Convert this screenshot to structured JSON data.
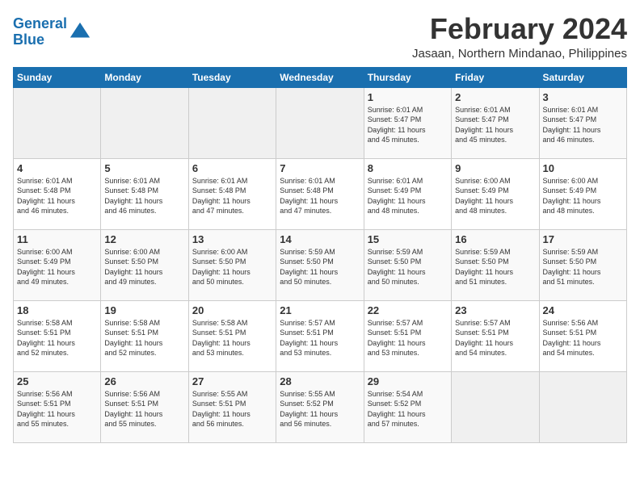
{
  "logo": {
    "line1": "General",
    "line2": "Blue"
  },
  "title": "February 2024",
  "subtitle": "Jasaan, Northern Mindanao, Philippines",
  "days_header": [
    "Sunday",
    "Monday",
    "Tuesday",
    "Wednesday",
    "Thursday",
    "Friday",
    "Saturday"
  ],
  "weeks": [
    [
      {
        "num": "",
        "info": ""
      },
      {
        "num": "",
        "info": ""
      },
      {
        "num": "",
        "info": ""
      },
      {
        "num": "",
        "info": ""
      },
      {
        "num": "1",
        "info": "Sunrise: 6:01 AM\nSunset: 5:47 PM\nDaylight: 11 hours\nand 45 minutes."
      },
      {
        "num": "2",
        "info": "Sunrise: 6:01 AM\nSunset: 5:47 PM\nDaylight: 11 hours\nand 45 minutes."
      },
      {
        "num": "3",
        "info": "Sunrise: 6:01 AM\nSunset: 5:47 PM\nDaylight: 11 hours\nand 46 minutes."
      }
    ],
    [
      {
        "num": "4",
        "info": "Sunrise: 6:01 AM\nSunset: 5:48 PM\nDaylight: 11 hours\nand 46 minutes."
      },
      {
        "num": "5",
        "info": "Sunrise: 6:01 AM\nSunset: 5:48 PM\nDaylight: 11 hours\nand 46 minutes."
      },
      {
        "num": "6",
        "info": "Sunrise: 6:01 AM\nSunset: 5:48 PM\nDaylight: 11 hours\nand 47 minutes."
      },
      {
        "num": "7",
        "info": "Sunrise: 6:01 AM\nSunset: 5:48 PM\nDaylight: 11 hours\nand 47 minutes."
      },
      {
        "num": "8",
        "info": "Sunrise: 6:01 AM\nSunset: 5:49 PM\nDaylight: 11 hours\nand 48 minutes."
      },
      {
        "num": "9",
        "info": "Sunrise: 6:00 AM\nSunset: 5:49 PM\nDaylight: 11 hours\nand 48 minutes."
      },
      {
        "num": "10",
        "info": "Sunrise: 6:00 AM\nSunset: 5:49 PM\nDaylight: 11 hours\nand 48 minutes."
      }
    ],
    [
      {
        "num": "11",
        "info": "Sunrise: 6:00 AM\nSunset: 5:49 PM\nDaylight: 11 hours\nand 49 minutes."
      },
      {
        "num": "12",
        "info": "Sunrise: 6:00 AM\nSunset: 5:50 PM\nDaylight: 11 hours\nand 49 minutes."
      },
      {
        "num": "13",
        "info": "Sunrise: 6:00 AM\nSunset: 5:50 PM\nDaylight: 11 hours\nand 50 minutes."
      },
      {
        "num": "14",
        "info": "Sunrise: 5:59 AM\nSunset: 5:50 PM\nDaylight: 11 hours\nand 50 minutes."
      },
      {
        "num": "15",
        "info": "Sunrise: 5:59 AM\nSunset: 5:50 PM\nDaylight: 11 hours\nand 50 minutes."
      },
      {
        "num": "16",
        "info": "Sunrise: 5:59 AM\nSunset: 5:50 PM\nDaylight: 11 hours\nand 51 minutes."
      },
      {
        "num": "17",
        "info": "Sunrise: 5:59 AM\nSunset: 5:50 PM\nDaylight: 11 hours\nand 51 minutes."
      }
    ],
    [
      {
        "num": "18",
        "info": "Sunrise: 5:58 AM\nSunset: 5:51 PM\nDaylight: 11 hours\nand 52 minutes."
      },
      {
        "num": "19",
        "info": "Sunrise: 5:58 AM\nSunset: 5:51 PM\nDaylight: 11 hours\nand 52 minutes."
      },
      {
        "num": "20",
        "info": "Sunrise: 5:58 AM\nSunset: 5:51 PM\nDaylight: 11 hours\nand 53 minutes."
      },
      {
        "num": "21",
        "info": "Sunrise: 5:57 AM\nSunset: 5:51 PM\nDaylight: 11 hours\nand 53 minutes."
      },
      {
        "num": "22",
        "info": "Sunrise: 5:57 AM\nSunset: 5:51 PM\nDaylight: 11 hours\nand 53 minutes."
      },
      {
        "num": "23",
        "info": "Sunrise: 5:57 AM\nSunset: 5:51 PM\nDaylight: 11 hours\nand 54 minutes."
      },
      {
        "num": "24",
        "info": "Sunrise: 5:56 AM\nSunset: 5:51 PM\nDaylight: 11 hours\nand 54 minutes."
      }
    ],
    [
      {
        "num": "25",
        "info": "Sunrise: 5:56 AM\nSunset: 5:51 PM\nDaylight: 11 hours\nand 55 minutes."
      },
      {
        "num": "26",
        "info": "Sunrise: 5:56 AM\nSunset: 5:51 PM\nDaylight: 11 hours\nand 55 minutes."
      },
      {
        "num": "27",
        "info": "Sunrise: 5:55 AM\nSunset: 5:51 PM\nDaylight: 11 hours\nand 56 minutes."
      },
      {
        "num": "28",
        "info": "Sunrise: 5:55 AM\nSunset: 5:52 PM\nDaylight: 11 hours\nand 56 minutes."
      },
      {
        "num": "29",
        "info": "Sunrise: 5:54 AM\nSunset: 5:52 PM\nDaylight: 11 hours\nand 57 minutes."
      },
      {
        "num": "",
        "info": ""
      },
      {
        "num": "",
        "info": ""
      }
    ]
  ]
}
